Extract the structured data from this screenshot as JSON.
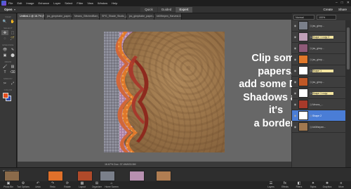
{
  "menubar": {
    "items": [
      "File",
      "Edit",
      "Image",
      "Enhance",
      "Layer",
      "Select",
      "Filter",
      "View",
      "Window",
      "Help"
    ],
    "window_controls": [
      "–",
      "□",
      "✕"
    ]
  },
  "modebar": {
    "open_label": "Open",
    "tabs": [
      "Quick",
      "Guided",
      "Expert"
    ],
    "active_tab": "Expert",
    "create_label": "Create",
    "share_label": "Share"
  },
  "doc_tabs": [
    "Untitled-1 @ 16.7% (Shape 2, RGB/8)",
    "jss_gimpbabe_paper-new orange.jpg",
    "Means_GlitchedBarn_JUL03.jpg",
    "SPG_Shade_Studio_pattern.jpg",
    "jss_gimpbabe_paper-peephole.jpg",
    "kb0thepen_Harvest-Dolls.jpg"
  ],
  "toolbox": {
    "sections": [
      "VIEW",
      "SELECT",
      "ENHANCE",
      "DRAW",
      "MODIFY",
      "COLOR"
    ],
    "tools": [
      "🔍",
      "✋",
      "✥",
      "⬚",
      "◌",
      "🪄",
      "👁",
      "✎",
      "▣",
      "⬤",
      "🖌",
      "▤",
      "T",
      "⌫",
      "✂",
      "⤢"
    ]
  },
  "canvas": {
    "status_text": "16.67%   Doc: 37.4M/433.5M",
    "callout_lines": [
      "Clip some papers,",
      "add some Drop",
      "Shadows and it's",
      "a border!"
    ]
  },
  "layers_panel": {
    "blend_mode": "Normal",
    "opacity": "100%",
    "layers": [
      {
        "name": "jss_gimp...",
        "thumb": "#7a7f8a",
        "highlight": false,
        "selected": false
      },
      {
        "name": "Shape 1 copy 2",
        "thumb": "#c0a0b8",
        "highlight": true,
        "selected": false
      },
      {
        "name": "jss_gimp...",
        "thumb": "#8e5a78",
        "highlight": false,
        "selected": false
      },
      {
        "name": "jss_gimp...",
        "thumb": "#e0782a",
        "highlight": false,
        "selected": false
      },
      {
        "name": "Shape 1",
        "thumb": "#ffffff",
        "highlight": true,
        "selected": false
      },
      {
        "name": "jss_gimp...",
        "thumb": "#c05826",
        "highlight": false,
        "selected": false
      },
      {
        "name": "Shape 1 copy",
        "thumb": "#ffffff",
        "highlight": true,
        "selected": false
      },
      {
        "name": "Means_...",
        "thumb": "#a83a2a",
        "highlight": false,
        "selected": false
      },
      {
        "name": "Shape 2",
        "thumb": "#ffffff",
        "highlight": false,
        "selected": true
      },
      {
        "name": "kb0thepen...",
        "thumb": "#a07850",
        "highlight": false,
        "selected": false
      }
    ]
  },
  "photo_bin": {
    "dropdown_label": "Show Open Files",
    "thumbs": [
      "#8a6a4a",
      "#e0702a",
      "#b04a2a",
      "#7a7f8a",
      "#b890b0",
      "#b07d52"
    ]
  },
  "taskbar": {
    "left": [
      {
        "icon": "▣",
        "label": "Photo Bin"
      },
      {
        "icon": "⚙",
        "label": "Tool Options"
      },
      {
        "icon": "↶",
        "label": "Undo"
      },
      {
        "icon": "↷",
        "label": "Redo"
      },
      {
        "icon": "⟳",
        "label": "Rotate"
      },
      {
        "icon": "▦",
        "label": "Layout"
      },
      {
        "icon": "⊞",
        "label": "Organizer"
      },
      {
        "icon": "⌂",
        "label": "Home Screen"
      }
    ],
    "right": [
      {
        "icon": "☰",
        "label": "Layers"
      },
      {
        "icon": "fx",
        "label": "Effects"
      },
      {
        "icon": "◧",
        "label": "Filters"
      },
      {
        "icon": "✦",
        "label": "Styles"
      },
      {
        "icon": "❖",
        "label": "Graphics"
      },
      {
        "icon": "≡",
        "label": "More"
      }
    ]
  }
}
